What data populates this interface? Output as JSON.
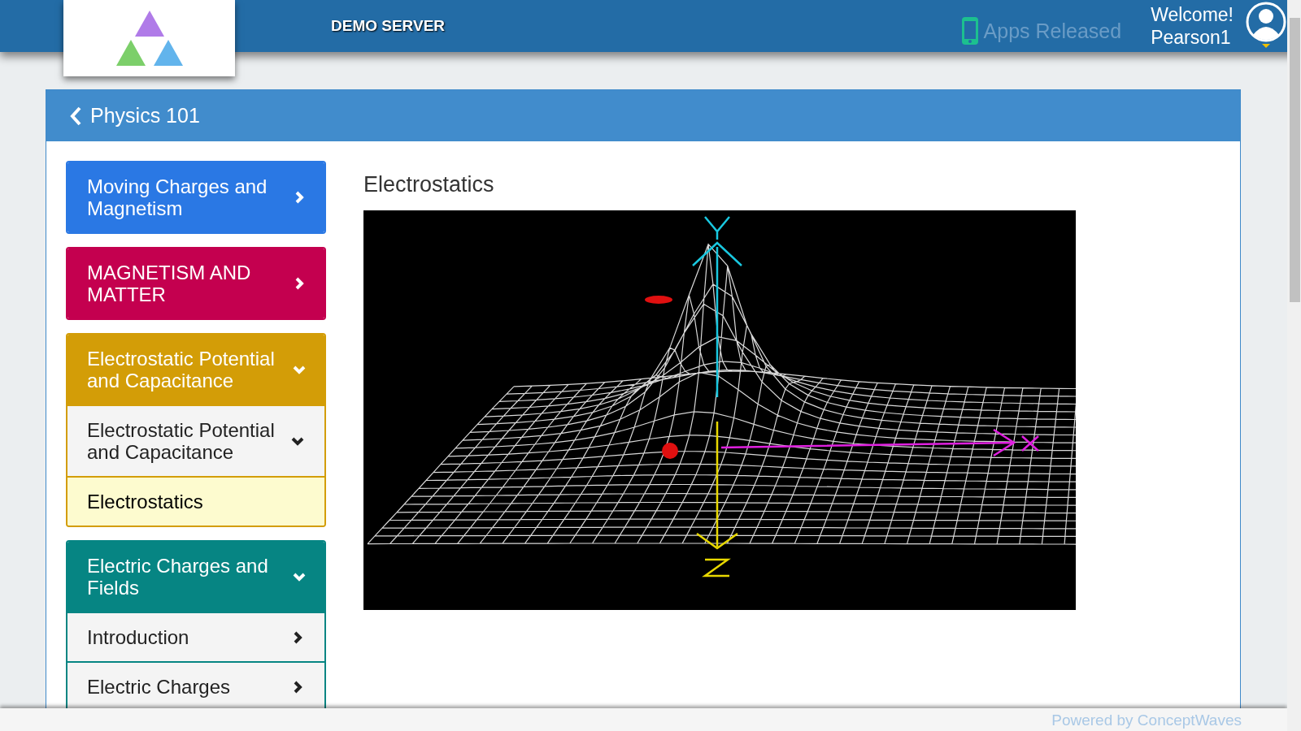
{
  "header": {
    "server_label": "DEMO SERVER",
    "apps_link": "Apps Released",
    "welcome": "Welcome!",
    "user": "Pearson1"
  },
  "course": {
    "title": "Physics 101"
  },
  "sidebar": {
    "groups": [
      {
        "title": "Moving Charges and Magnetism",
        "color": "#2a78e4",
        "expanded": false
      },
      {
        "title": "MAGNETISM AND MATTER",
        "color": "#c4004f",
        "expanded": false
      },
      {
        "title": "Electrostatic Potential and Capacitance",
        "color": "#d39d07",
        "expanded": true,
        "items": [
          {
            "label": "Electrostatic Potential and Capacitance",
            "kind": "section",
            "expanded": true,
            "selected": false,
            "children": [
              {
                "label": "Electrostatics",
                "kind": "page",
                "selected": true
              }
            ]
          }
        ]
      },
      {
        "title": "Electric Charges and Fields",
        "color": "#068583",
        "expanded": true,
        "items": [
          {
            "label": "Introduction",
            "kind": "section",
            "expanded": false,
            "selected": false
          },
          {
            "label": "Electric Charges",
            "kind": "section",
            "expanded": false,
            "selected": false
          }
        ]
      }
    ]
  },
  "content": {
    "title": "Electrostatics"
  },
  "footer": {
    "text": "Powered by ConceptWaves"
  }
}
